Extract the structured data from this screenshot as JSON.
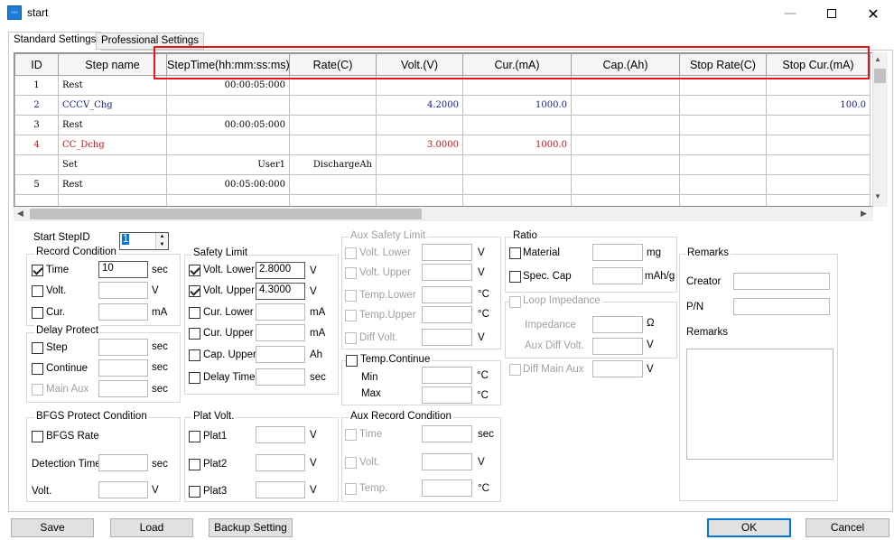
{
  "window": {
    "title": "start",
    "icon": "waveform-app-icon"
  },
  "tabs": [
    {
      "label": "Standard Settings"
    },
    {
      "label": "Professional Settings"
    }
  ],
  "grid": {
    "columns": [
      "ID",
      "Step name",
      "StepTime(hh:mm:ss:ms)",
      "Rate(C)",
      "Volt.(V)",
      "Cur.(mA)",
      "Cap.(Ah)",
      "Stop Rate(C)",
      "Stop Cur.(mA)"
    ],
    "rows": [
      {
        "id": "1",
        "name": "Rest",
        "time": "00:00:05:000",
        "rate": "",
        "volt": "",
        "cur": "",
        "cap": "",
        "stoprate": "",
        "stopcur": "",
        "color": "#000000"
      },
      {
        "id": "2",
        "name": "CCCV_Chg",
        "time": "",
        "rate": "",
        "volt": "4.2000",
        "cur": "1000.0",
        "cap": "",
        "stoprate": "",
        "stopcur": "100.0",
        "color": "#1a1aa6"
      },
      {
        "id": "3",
        "name": "Rest",
        "time": "00:00:05:000",
        "rate": "",
        "volt": "",
        "cur": "",
        "cap": "",
        "stoprate": "",
        "stopcur": "",
        "color": "#000000"
      },
      {
        "id": "4",
        "name": "CC_Dchg",
        "time": "",
        "rate": "",
        "volt": "3.0000",
        "cur": "1000.0",
        "cap": "",
        "stoprate": "",
        "stopcur": "",
        "color": "#d01010"
      },
      {
        "id": "",
        "name": "Set",
        "time": "User1",
        "rate": "DischargeAh",
        "volt": "",
        "cur": "",
        "cap": "",
        "stoprate": "",
        "stopcur": "",
        "color": "#000000"
      },
      {
        "id": "5",
        "name": "Rest",
        "time": "00:05:00:000",
        "rate": "",
        "volt": "",
        "cur": "",
        "cap": "",
        "stoprate": "",
        "stopcur": "",
        "color": "#000000"
      },
      {
        "id": "",
        "name": "",
        "time": "",
        "rate": "",
        "volt": "",
        "cur": "",
        "cap": "",
        "stoprate": "",
        "stopcur": "",
        "color": "#000000"
      }
    ]
  },
  "start_step": {
    "label": "Start StepID",
    "value": "1"
  },
  "record": {
    "legend": "Record Condition",
    "time": "Time",
    "time_val": "10",
    "volt": "Volt.",
    "cur": "Cur.",
    "sec": "sec",
    "v": "V",
    "ma": "mA"
  },
  "delay": {
    "legend": "Delay Protect",
    "step": "Step",
    "cont": "Continue",
    "main": "Main Aux",
    "sec": "sec"
  },
  "safety": {
    "legend": "Safety Limit",
    "vlower": "Volt. Lower",
    "vlower_val": "2.8000",
    "vupper": "Volt. Upper",
    "vupper_val": "4.3000",
    "clower": "Cur. Lower",
    "cupper": "Cur. Upper",
    "capupper": "Cap. Upper",
    "delay": "Delay Time",
    "v": "V",
    "ma": "mA",
    "ah": "Ah",
    "sec": "sec"
  },
  "aux": {
    "legend": "Aux Safety Limit",
    "vlower": "Volt. Lower",
    "vupper": "Volt. Upper",
    "tlower": "Temp.Lower",
    "tupper": "Temp.Upper",
    "diff": "Diff Volt.",
    "v": "V",
    "c": "°C"
  },
  "tempcont": {
    "label": "Temp.Continue",
    "min": "Min",
    "max": "Max",
    "c": "°C"
  },
  "ratio": {
    "legend": "Ratio",
    "material": "Material",
    "spec": "Spec. Cap",
    "mg": "mg",
    "mahg": "mAh/g"
  },
  "loop": {
    "label": "Loop Impedance",
    "imp": "Impedance",
    "aux": "Aux Diff Volt.",
    "omega": "Ω",
    "v": "V",
    "diffmain": "Diff Main Aux"
  },
  "remarks": {
    "legend": "Remarks",
    "creator": "Creator",
    "pn": "P/N",
    "remarks": "Remarks"
  },
  "bfgs": {
    "legend": "BFGS Protect Condition",
    "rate": "BFGS Rate",
    "det": "Detection Time",
    "volt": "Volt.",
    "sec": "sec",
    "v": "V"
  },
  "plat": {
    "legend": "Plat Volt.",
    "p1": "Plat1",
    "p2": "Plat2",
    "p3": "Plat3",
    "v": "V"
  },
  "auxrec": {
    "legend": "Aux Record Condition",
    "time": "Time",
    "volt": "Volt.",
    "temp": "Temp.",
    "sec": "sec",
    "v": "V",
    "c": "°C"
  },
  "buttons": {
    "save": "Save",
    "load": "Load",
    "backup": "Backup Setting",
    "ok": "OK",
    "cancel": "Cancel"
  },
  "colors": {
    "highlight": "#e8141a",
    "accent": "#0078d7"
  }
}
